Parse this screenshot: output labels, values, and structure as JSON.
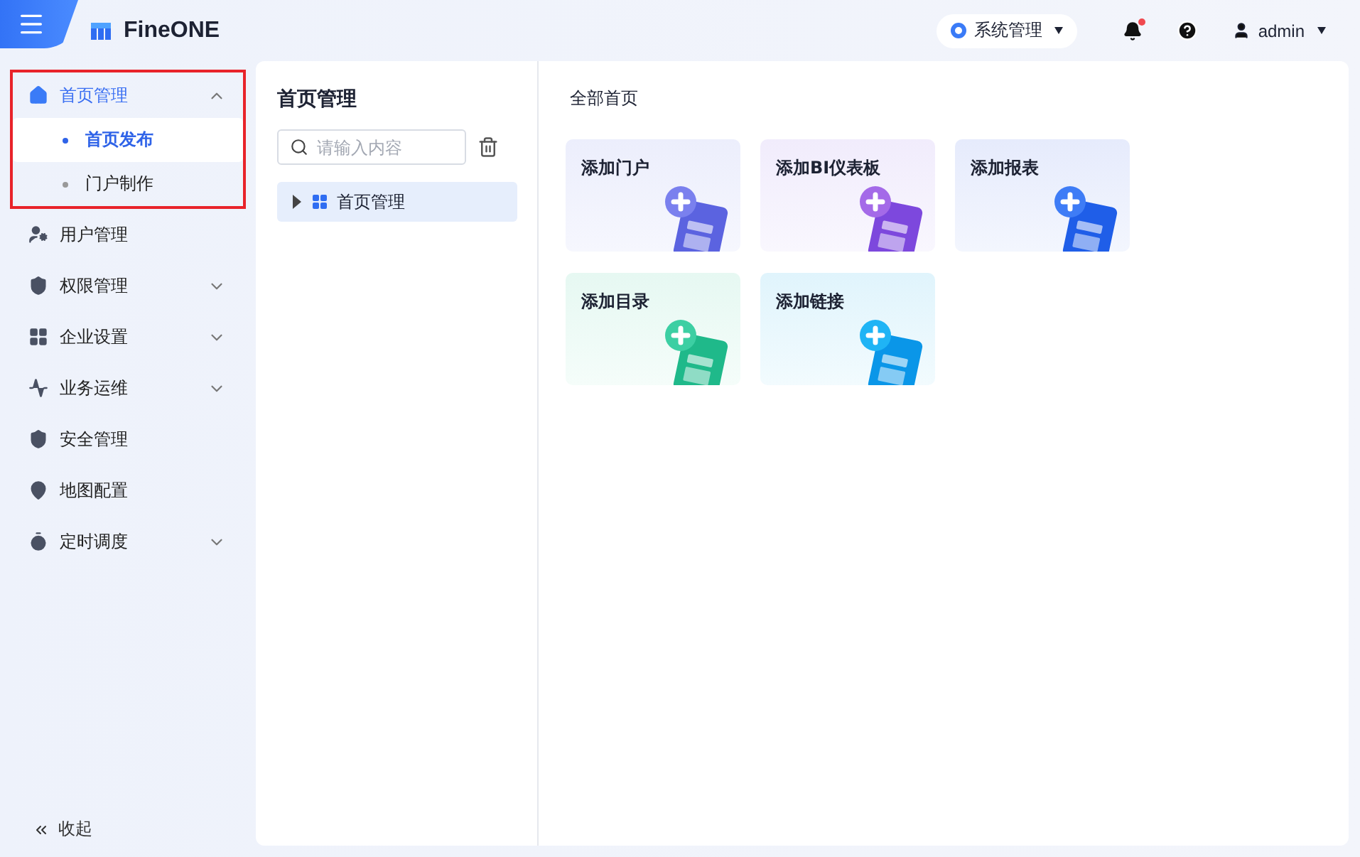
{
  "header": {
    "logo": "FineONE",
    "system_menu": "系统管理",
    "notifications": {
      "unread": true
    },
    "user": "admin"
  },
  "sidebar": {
    "items": [
      {
        "label": "首页管理",
        "kind": "home",
        "expanded": true,
        "selected": true,
        "highlighted": true,
        "children": [
          {
            "label": "首页发布",
            "selected": true
          },
          {
            "label": "门户制作",
            "selected": false
          }
        ]
      },
      {
        "label": "用户管理",
        "kind": "user",
        "selected": false
      },
      {
        "label": "权限管理",
        "kind": "shield-lock",
        "expanded": false,
        "selected": false
      },
      {
        "label": "企业设置",
        "kind": "grid",
        "expanded": false,
        "selected": false
      },
      {
        "label": "业务运维",
        "kind": "ops",
        "expanded": false,
        "selected": false
      },
      {
        "label": "安全管理",
        "kind": "shield",
        "selected": false
      },
      {
        "label": "地图配置",
        "kind": "map",
        "selected": false
      },
      {
        "label": "定时调度",
        "kind": "timer",
        "expanded": false,
        "selected": false
      }
    ],
    "collapse": "收起"
  },
  "tree_panel": {
    "title": "首页管理",
    "search": {
      "placeholder": "请输入内容"
    },
    "tree": [
      {
        "label": "首页管理",
        "expanded": false,
        "selected": true
      }
    ]
  },
  "content": {
    "title": "全部首页",
    "cards": [
      {
        "label": "添加门户",
        "kind": "portal"
      },
      {
        "label": "添加BI仪表板",
        "kind": "dashboard"
      },
      {
        "label": "添加报表",
        "kind": "report"
      },
      {
        "label": "添加目录",
        "kind": "catalog"
      },
      {
        "label": "添加链接",
        "kind": "link"
      }
    ]
  }
}
